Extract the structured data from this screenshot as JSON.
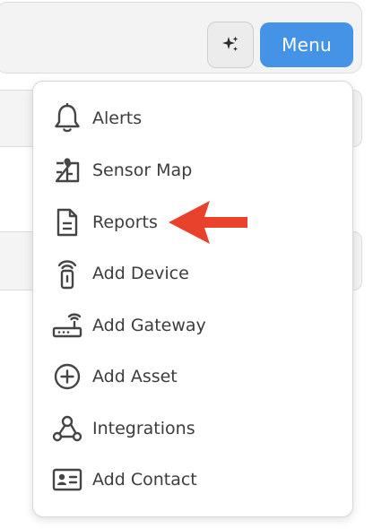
{
  "header": {
    "menu_label": "Menu",
    "sparkle_icon": "sparkle-icon"
  },
  "menu": {
    "items": [
      {
        "label": "Alerts",
        "icon": "bell-icon"
      },
      {
        "label": "Sensor Map",
        "icon": "sensor-map-icon"
      },
      {
        "label": "Reports",
        "icon": "document-icon"
      },
      {
        "label": "Add Device",
        "icon": "sensor-device-icon"
      },
      {
        "label": "Add Gateway",
        "icon": "gateway-icon"
      },
      {
        "label": "Add Asset",
        "icon": "plus-circle-icon"
      },
      {
        "label": "Integrations",
        "icon": "integrations-icon"
      },
      {
        "label": "Add Contact",
        "icon": "contact-card-icon"
      }
    ]
  },
  "annotation": {
    "arrow_color": "#e8412c",
    "points_to": "Reports"
  },
  "colors": {
    "menu_button": "#4593e6",
    "icon": "#454545",
    "text": "#3c3c3c"
  }
}
